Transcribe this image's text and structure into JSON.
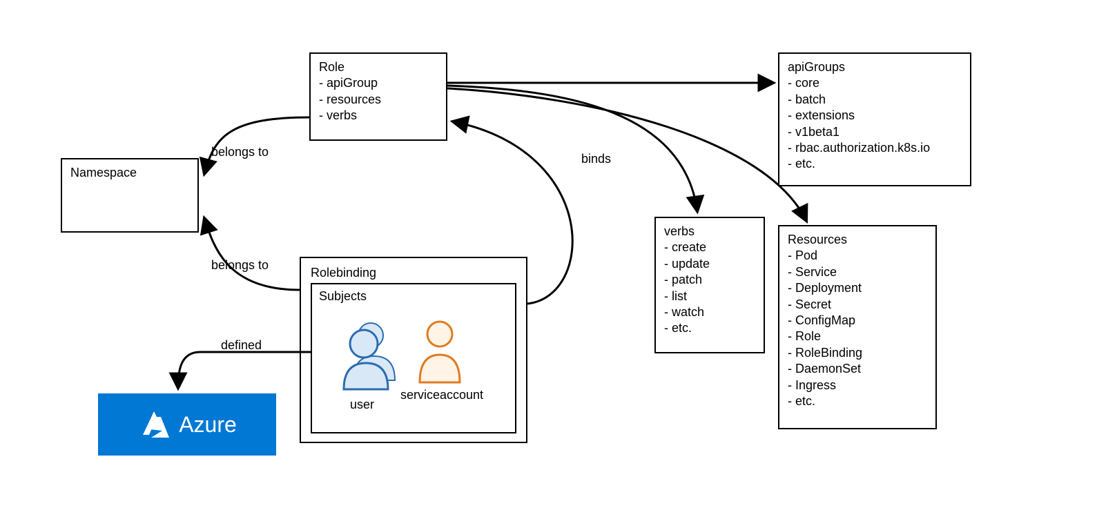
{
  "namespace": {
    "title": "Namespace"
  },
  "role": {
    "title": "Role",
    "items": [
      "- apiGroup",
      "- resources",
      "- verbs"
    ]
  },
  "apiGroups": {
    "title": "apiGroups",
    "items": [
      "- core",
      "- batch",
      "- extensions",
      "- v1beta1",
      "- rbac.authorization.k8s.io",
      "- etc."
    ]
  },
  "verbs": {
    "title": "verbs",
    "items": [
      "- create",
      "- update",
      "- patch",
      "- list",
      "- watch",
      "- etc."
    ]
  },
  "resources": {
    "title": "Resources",
    "items": [
      "- Pod",
      "- Service",
      "- Deployment",
      "- Secret",
      "- ConfigMap",
      "- Role",
      "- RoleBinding",
      "- DaemonSet",
      "- Ingress",
      "- etc."
    ]
  },
  "rolebinding": {
    "title": "Rolebinding",
    "subjects_title": "Subjects",
    "user_label": "user",
    "sa_label": "serviceaccount"
  },
  "azure": {
    "label": "Azure"
  },
  "edges": {
    "belongs_to_1": "belongs to",
    "belongs_to_2": "belongs to",
    "defined": "defined",
    "binds": "binds"
  }
}
